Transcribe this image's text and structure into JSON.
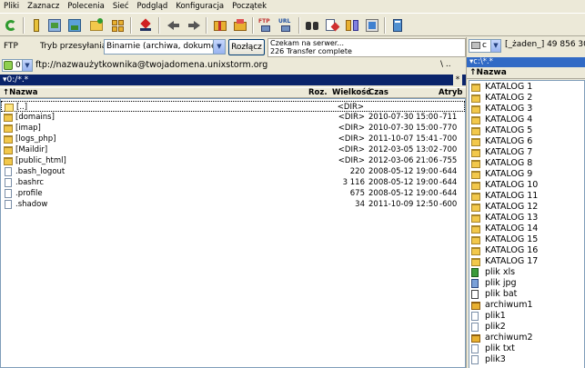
{
  "menu": [
    "Pliki",
    "Zaznacz",
    "Polecenia",
    "Sieć",
    "Podgląd",
    "Konfiguracja",
    "Początek"
  ],
  "ftp": {
    "label": "FTP",
    "mode_label": "Tryb przesyłania",
    "mode_value": "Binarnie (archiwa, dokumen",
    "disconnect": "Rozłącz",
    "status_line1": "Czekam na serwer...",
    "status_line2": "226 Transfer complete"
  },
  "remote": {
    "connection_num": "0",
    "connection_path": "ftp://nazwaużytkownika@twojadomena.unixstorm.org",
    "path_tools": "\\ ..",
    "path": "0:/*.*",
    "headers": {
      "name": "↑Nazwa",
      "ext": "Roz.",
      "size": "Wielkość",
      "time": "Czas",
      "attr": "Atryb"
    },
    "rows": [
      {
        "icon": "up",
        "name": "[..]",
        "size": "<DIR>",
        "time": "",
        "attr": "",
        "selected": true
      },
      {
        "icon": "folder",
        "name": "[domains]",
        "size": "<DIR>",
        "time": "2010-07-30 15:00",
        "attr": "-711"
      },
      {
        "icon": "folder",
        "name": "[imap]",
        "size": "<DIR>",
        "time": "2010-07-30 15:00",
        "attr": "-770"
      },
      {
        "icon": "folder",
        "name": "[logs_php]",
        "size": "<DIR>",
        "time": "2011-10-07 15:41",
        "attr": "-700"
      },
      {
        "icon": "folder",
        "name": "[Maildir]",
        "size": "<DIR>",
        "time": "2012-03-05 13:02",
        "attr": "-700"
      },
      {
        "icon": "folder",
        "name": "[public_html]",
        "size": "<DIR>",
        "time": "2012-03-06 21:06",
        "attr": "-755"
      },
      {
        "icon": "doc",
        "name": ".bash_logout",
        "size": "220",
        "time": "2008-05-12 19:00",
        "attr": "-644"
      },
      {
        "icon": "doc",
        "name": ".bashrc",
        "size": "3 116",
        "time": "2008-05-12 19:00",
        "attr": "-644"
      },
      {
        "icon": "doc",
        "name": ".profile",
        "size": "675",
        "time": "2008-05-12 19:00",
        "attr": "-644"
      },
      {
        "icon": "doc",
        "name": ".shadow",
        "size": "34",
        "time": "2011-10-09 12:50",
        "attr": "-600"
      }
    ]
  },
  "local": {
    "drive": "c",
    "drive_info": "[_żaden_]  49 856 30",
    "path": "c:\\*.*",
    "header": "Nazwa",
    "items": [
      {
        "icon": "folder",
        "name": "KATALOG 1"
      },
      {
        "icon": "folder",
        "name": "KATALOG 2"
      },
      {
        "icon": "folder",
        "name": "KATALOG 3"
      },
      {
        "icon": "folder",
        "name": "KATALOG 4"
      },
      {
        "icon": "folder",
        "name": "KATALOG 5"
      },
      {
        "icon": "folder",
        "name": "KATALOG 6"
      },
      {
        "icon": "folder",
        "name": "KATALOG 7"
      },
      {
        "icon": "folder",
        "name": "KATALOG 8"
      },
      {
        "icon": "folder",
        "name": "KATALOG 9"
      },
      {
        "icon": "folder",
        "name": "KATALOG 10"
      },
      {
        "icon": "folder",
        "name": "KATALOG 11"
      },
      {
        "icon": "folder",
        "name": "KATALOG 12"
      },
      {
        "icon": "folder",
        "name": "KATALOG 13"
      },
      {
        "icon": "folder",
        "name": "KATALOG 14"
      },
      {
        "icon": "folder",
        "name": "KATALOG 15"
      },
      {
        "icon": "folder",
        "name": "KATALOG 16"
      },
      {
        "icon": "folder",
        "name": "KATALOG 17"
      },
      {
        "icon": "xls-file",
        "name": "plik xls"
      },
      {
        "icon": "image-file",
        "name": "plik jpg"
      },
      {
        "icon": "bat-file",
        "name": "plik bat"
      },
      {
        "icon": "archive-file",
        "name": "archiwum1"
      },
      {
        "icon": "doc",
        "name": "plik1"
      },
      {
        "icon": "doc",
        "name": "plik2"
      },
      {
        "icon": "archive-file",
        "name": "archiwum2"
      },
      {
        "icon": "doc",
        "name": "plik txt"
      },
      {
        "icon": "doc",
        "name": "plik3"
      }
    ]
  },
  "colors": {
    "path_active": "#0a246a",
    "path_inactive": "#316ac5",
    "folder": "#f2c84b"
  }
}
